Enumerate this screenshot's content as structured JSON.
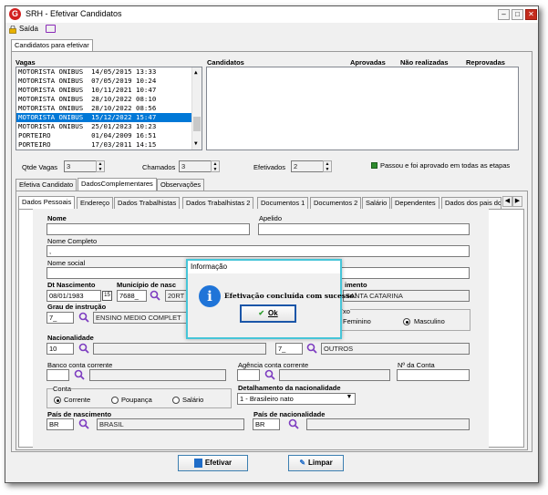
{
  "window": {
    "title": "SRH - Efetivar Candidatos",
    "app_initial": "G"
  },
  "menu": {
    "exit_label": "Saída"
  },
  "top_tab": {
    "label": "Candidatos para efetivar"
  },
  "vagas": {
    "header": "Vagas",
    "rows": [
      "MOTORISTA ONIBUS  14/05/2015 13:33",
      "MOTORISTA ONIBUS  07/05/2019 10:24",
      "MOTORISTA ONIBUS  10/11/2021 10:47",
      "MOTORISTA ONIBUS  28/10/2022 08:10",
      "MOTORISTA ONIBUS  28/10/2022 08:56",
      "MOTORISTA ONIBUS  15/12/2022 15:47",
      "MOTORISTA ONIBUS  25/01/2023 10:23",
      "PORTEIRO          01/04/2009 16:51",
      "PORTEIRO          17/03/2011 14:15"
    ],
    "selected_index": 5
  },
  "candidatos": {
    "headers": [
      "Candidatos",
      "Aprovadas",
      "Não realizadas",
      "Reprovadas"
    ]
  },
  "counters": {
    "qtde_label": "Qtde Vagas",
    "qtde_value": "3",
    "chamados_label": "Chamados",
    "chamados_value": "3",
    "efetivados_label": "Efetivados",
    "efetivados_value": "2",
    "legend": "Passou e foi aprovado em todas as etapas",
    "legend_color": "#2e8b2e"
  },
  "sub_tabs": [
    "Efetiva Candidato",
    "DadosComplementares",
    "Observações"
  ],
  "inner_tabs": [
    "Dados Pessoais",
    "Endereço",
    "Dados Trabalhistas",
    "Dados Trabalhistas 2",
    "Documentos 1",
    "Documentos 2",
    "Salário",
    "Dependentes",
    "Dados dos pais do"
  ],
  "form": {
    "nome_label": "Nome",
    "apelido_label": "Apelido",
    "nome_completo_label": "Nome Completo",
    "nome_completo_value": ",",
    "nome_social_label": "Nome social",
    "dt_nasc_label": "Dt Nascimento",
    "dt_nasc_value": "08/01/1983",
    "municipio_label": "Município de nasc",
    "municipio_code": "7688_",
    "municipio_name": "20RT",
    "uf_label": "imento",
    "uf_value": "SANTA CATARINA",
    "grau_label": "Grau de instrução",
    "grau_code": "7_",
    "grau_value": "ENSINO MEDIO COMPLET",
    "sexo_label": "xo",
    "sexo_f": "Feminino",
    "sexo_m": "Masculino",
    "nacionalidade_label": "Nacionalidade",
    "nacionalidade_value": "10",
    "raca_code": "7_",
    "raca_value": "OUTROS",
    "banco_label": "Banco conta corrente",
    "agencia_label": "Agência conta corrente",
    "conta_label": "Nº da Conta",
    "tipo_conta_label": "Conta",
    "tipo_corrente": "Corrente",
    "tipo_poupanca": "Poupança",
    "tipo_salario": "Salário",
    "detalhamento_label": "Detalhamento da nacionalidade",
    "detalhamento_value": "1 - Brasileiro nato",
    "pais_nasc_label": "País de nascimento",
    "pais_nasc_code": "BR",
    "pais_nasc_name": "BRASIL",
    "pais_nac_label": "País de nacionalidade",
    "pais_nac_code": "BR"
  },
  "dialog": {
    "title": "Informação",
    "message": "Efetivação concluída com sucesso!",
    "ok_label": "Ok"
  },
  "buttons": {
    "efetivar": "Efetivar",
    "limpar": "Limpar"
  }
}
